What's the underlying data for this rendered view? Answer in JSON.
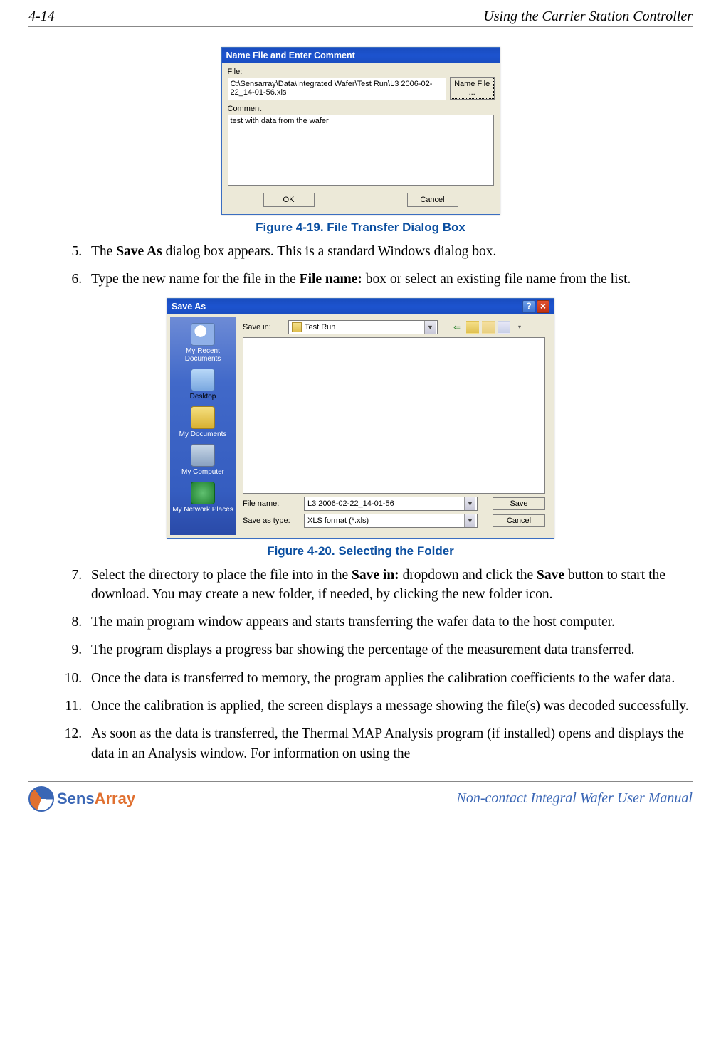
{
  "header": {
    "page_num": "4-14",
    "section": "Using the Carrier Station Controller"
  },
  "fig1": {
    "caption": "Figure 4-19. File Transfer Dialog Box",
    "title": "Name File and Enter Comment",
    "file_label": "File:",
    "file_value": "C:\\Sensarray\\Data\\Integrated Wafer\\Test Run\\L3 2006-02-22_14-01-56.xls",
    "namefile_btn": "Name File ...",
    "comment_label": "Comment",
    "comment_value": "test with data from the wafer",
    "ok": "OK",
    "cancel": "Cancel"
  },
  "steps": {
    "s5": "The Save As dialog box appears. This is a standard Windows dialog box.",
    "s6": "Type the new name for the file in the File name: box or select an existing file name from the list.",
    "s7": "Select the directory to place the file into in the Save in: dropdown and click the Save button to start the download. You may create a new folder, if needed, by clicking the new folder icon.",
    "s8": "The main program window appears and starts transferring the wafer data to the host computer.",
    "s9": "The program displays a progress bar showing the percentage of the measurement data transferred.",
    "s10": "Once the data is transferred to memory, the program applies the calibration coefficients to the wafer data.",
    "s11": "Once the calibration is applied, the screen displays a message showing the file(s) was decoded successfully.",
    "s12": "As soon as the data is transferred, the Thermal MAP Analysis program (if installed) opens and displays the data in an Analysis window. For information on using the"
  },
  "fig2": {
    "caption": "Figure 4-20. Selecting the Folder",
    "title": "Save As",
    "savein_label": "Save in:",
    "savein_value": "Test Run",
    "sidebar": {
      "recent": "My Recent Documents",
      "desktop": "Desktop",
      "mydocs": "My Documents",
      "mycomp": "My Computer",
      "mynet": "My Network Places"
    },
    "filename_label": "File name:",
    "filename_value": "L3 2006-02-22_14-01-56",
    "saveastype_label": "Save as type:",
    "saveastype_value": "XLS format (*.xls)",
    "save_btn": "Save",
    "cancel_btn": "Cancel"
  },
  "footer": {
    "logo_sens": "Sens",
    "logo_array": "Array",
    "manual": "Non-contact Integral Wafer User Manual"
  }
}
